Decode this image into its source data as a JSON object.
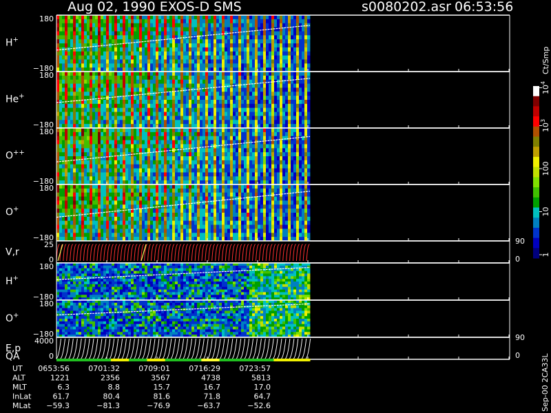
{
  "chart_data": {
    "type": "heatmap",
    "title": "Aug 02, 1990   EXOS-D SMS",
    "file": "s0080202.asr",
    "time": "06:53:56",
    "side_label": "Sep-00 2CA33L",
    "panels": [
      {
        "id": "h1",
        "label": "H",
        "sup": "+",
        "ylim": [
          -180,
          180
        ],
        "ticks": [
          "180",
          "−180"
        ],
        "kind": "strip",
        "stripes": true,
        "hot": 0.78,
        "curve": [
          0.62,
          0.18
        ]
      },
      {
        "id": "he",
        "label": "He",
        "sup": "+",
        "ylim": [
          -180,
          180
        ],
        "ticks": [
          "180",
          "−180"
        ],
        "kind": "strip",
        "stripes": true,
        "hot": 0.6,
        "curve": [
          0.55,
          0.12
        ]
      },
      {
        "id": "o2",
        "label": "O",
        "sup": "++",
        "ylim": [
          -180,
          180
        ],
        "ticks": [
          "180",
          "−180"
        ],
        "kind": "strip",
        "stripes": true,
        "hot": 0.62,
        "curve": [
          0.6,
          0.15
        ]
      },
      {
        "id": "o1",
        "label": "O",
        "sup": "+",
        "ylim": [
          -180,
          180
        ],
        "ticks": [
          "180",
          "−180"
        ],
        "kind": "strip",
        "stripes": true,
        "hot": 0.55,
        "curve": [
          0.58,
          0.12
        ]
      },
      {
        "id": "vr",
        "label": "V,r",
        "sup": "",
        "ylim": [
          0,
          25
        ],
        "ticks": [
          "25",
          "0"
        ],
        "right_ticks": [
          "90",
          "0"
        ],
        "kind": "sawtooth"
      },
      {
        "id": "h2",
        "label": "H",
        "sup": "+",
        "ylim": [
          -180,
          180
        ],
        "ticks": [
          "180",
          "−180"
        ],
        "kind": "strip",
        "stripes": false,
        "hot": 0.25,
        "curve": [
          0.45,
          0.12
        ]
      },
      {
        "id": "o3",
        "label": "O",
        "sup": "+",
        "ylim": [
          -180,
          180
        ],
        "ticks": [
          "180",
          "−180"
        ],
        "kind": "strip",
        "stripes": false,
        "hot": 0.3,
        "curve": [
          0.4,
          0.1
        ]
      },
      {
        "id": "ep",
        "label": "E,p",
        "sup": "",
        "ylim": [
          0,
          4000
        ],
        "ticks": [
          "4000",
          "0"
        ],
        "right_ticks": [
          "90",
          "0"
        ],
        "kind": "curves"
      }
    ],
    "qa_label": "QA",
    "colorbar": {
      "label": "Ct/Smp",
      "ticks": [
        {
          "text": "1",
          "frac": 0.02
        },
        {
          "text": "10",
          "frac": 0.27
        },
        {
          "text": "100",
          "frac": 0.52
        },
        {
          "text": "10",
          "sup": "3",
          "frac": 0.77
        },
        {
          "text": "10",
          "sup": "4",
          "frac": 0.99
        }
      ],
      "colors": [
        "#00007f",
        "#0000bf",
        "#0033cc",
        "#0080c0",
        "#00c0c0",
        "#00a000",
        "#40c000",
        "#80e000",
        "#c0e000",
        "#f0f000",
        "#c0a000",
        "#808000",
        "#b05000",
        "#ff0000",
        "#c00000",
        "#800000",
        "#ffffff"
      ]
    },
    "footer": {
      "rows": [
        {
          "label": "UT",
          "values": [
            "0653:56",
            "0701:32",
            "0709:01",
            "0716:29",
            "0723:57"
          ]
        },
        {
          "label": "ALT",
          "values": [
            "1221",
            "2356",
            "3567",
            "4738",
            "5813"
          ]
        },
        {
          "label": "MLT",
          "values": [
            "6.3",
            "8.8",
            "15.7",
            "16.7",
            "17.0"
          ]
        },
        {
          "label": "InLat",
          "values": [
            "61.7",
            "80.4",
            "81.6",
            "71.8",
            "64.7"
          ]
        },
        {
          "label": "MLat",
          "values": [
            "−59.3",
            "−81.3",
            "−76.9",
            "−63.7",
            "−52.6"
          ]
        }
      ]
    }
  }
}
